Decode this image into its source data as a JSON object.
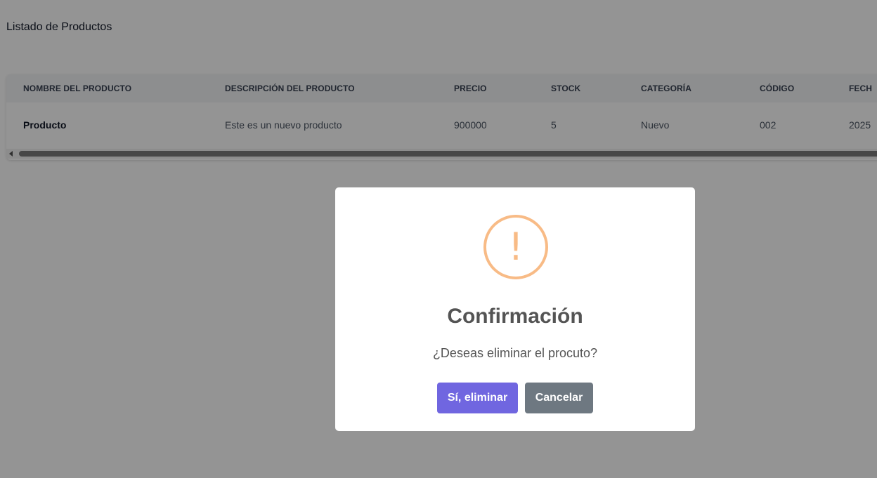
{
  "page": {
    "title": "Listado de Productos"
  },
  "table": {
    "headers": [
      "NOMBRE DEL PRODUCTO",
      "DESCRIPCIÓN DEL PRODUCTO",
      "PRECIO",
      "STOCK",
      "CATEGORÍA",
      "CÓDIGO",
      "FECH"
    ],
    "rows": [
      [
        "Producto",
        "Este es un nuevo producto",
        "900000",
        "5",
        "Nuevo",
        "002",
        "2025"
      ]
    ]
  },
  "modal": {
    "icon": "exclamation-icon",
    "icon_glyph": "!",
    "icon_color": "#f8bb86",
    "title": "Confirmación",
    "text": "¿Deseas eliminar el procuto?",
    "confirm_label": "Sí, eliminar",
    "cancel_label": "Cancelar",
    "confirm_color": "#7066e0",
    "cancel_color": "#6e7881"
  }
}
